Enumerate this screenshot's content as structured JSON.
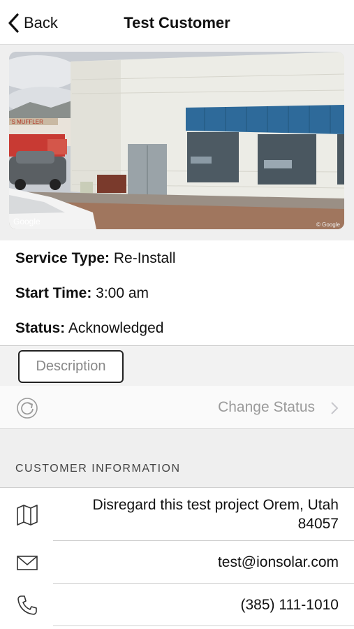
{
  "nav": {
    "back_label": "Back",
    "title": "Test Customer"
  },
  "photo": {
    "watermark_left": "Google",
    "watermark_right": "© Google",
    "sign_text": "'S MUFFLER"
  },
  "details": {
    "service_type_label": "Service Type:",
    "service_type_value": "Re-Install",
    "start_time_label": "Start Time:",
    "start_time_value": "3:00 am",
    "status_label": "Status:",
    "status_value": "Acknowledged"
  },
  "description_button": "Description",
  "change_status": {
    "label": "Change Status",
    "icon": "refresh-icon"
  },
  "customer_info": {
    "section_title": "CUSTOMER INFORMATION",
    "address_line1": "Disregard this test project Orem, Utah",
    "address_line2": "84057",
    "email": "test@ionsolar.com",
    "phone": "(385) 111-1010",
    "icons": [
      "map-icon",
      "mail-icon",
      "phone-icon"
    ]
  }
}
